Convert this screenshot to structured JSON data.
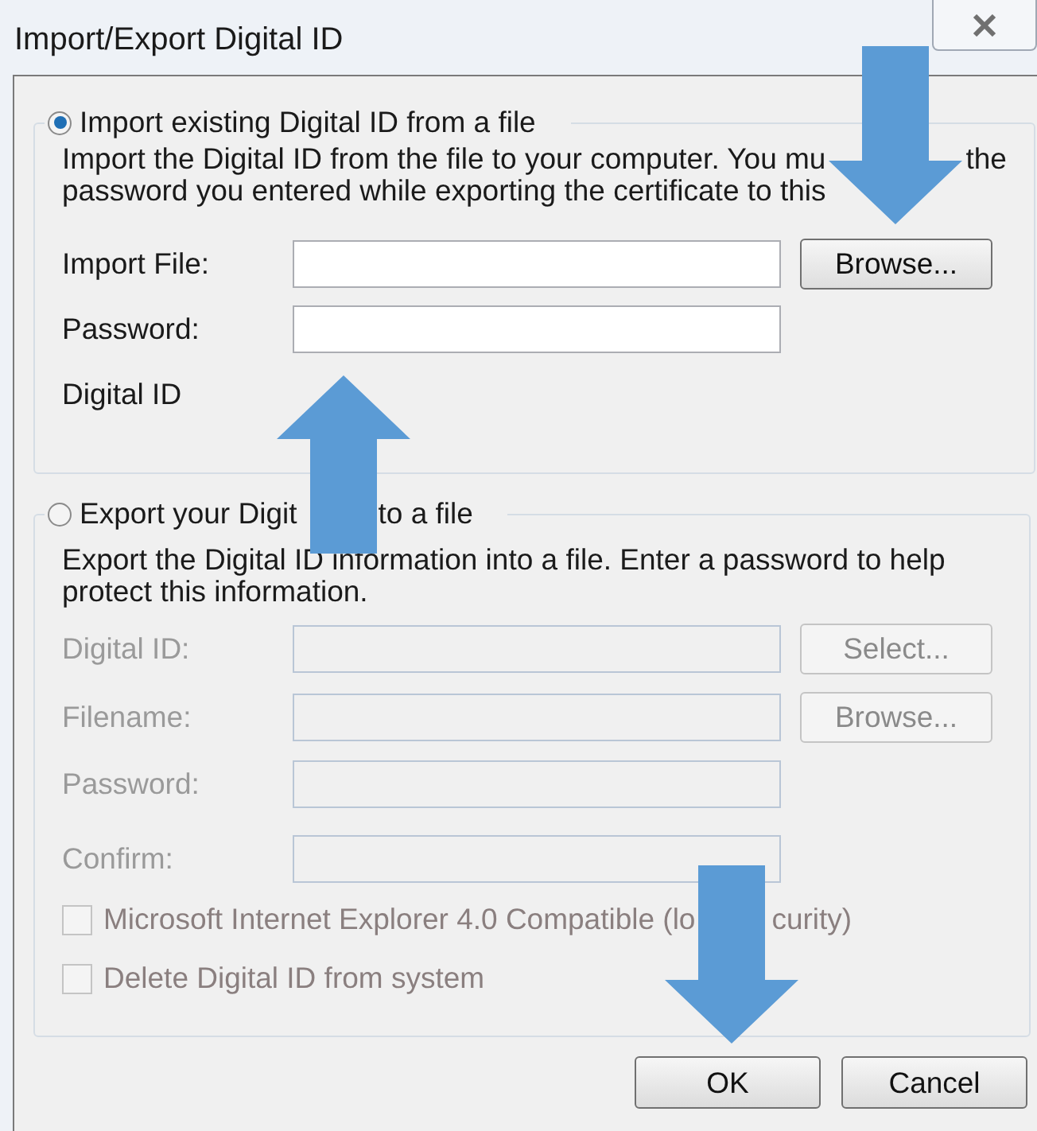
{
  "window": {
    "title": "Import/Export Digital ID"
  },
  "import_section": {
    "selected": true,
    "label": [
      "Import existing Digital ID from a file"
    ],
    "description": [
      [
        "Import the Digital ID from the file to your computer. You mu",
        "the"
      ],
      [
        "password you entered while exporting the certificate to this"
      ]
    ],
    "fields": [
      {
        "label": "Import File:",
        "disabled": false,
        "button": "Browse..."
      },
      {
        "label": "Password:",
        "disabled": false
      }
    ],
    "digital_id_label": "Digital ID"
  },
  "export_section": {
    "selected": false,
    "label": [
      "Export your Digit",
      "to a file"
    ],
    "description": [
      [
        "Export the Digital ID information into a file. Enter a password to help"
      ],
      [
        "protect this information."
      ]
    ],
    "fields": [
      {
        "label": "Digital ID:",
        "disabled": true,
        "button": "Select..."
      },
      {
        "label": "Filename:",
        "disabled": true,
        "button": "Browse..."
      },
      {
        "label": "Password:",
        "disabled": true
      },
      {
        "label": "Confirm:",
        "disabled": true
      }
    ],
    "checkboxes": [
      {
        "label": [
          "Microsoft Internet Explorer 4.0 Compatible (lo",
          "curity)"
        ],
        "checked": false,
        "disabled": true
      },
      {
        "label": [
          "Delete Digital ID from system"
        ],
        "checked": false,
        "disabled": true
      }
    ]
  },
  "buttons": [
    "OK",
    "Cancel"
  ],
  "annotations": [
    {
      "kind": "arrow_down"
    },
    {
      "kind": "arrow_up"
    },
    {
      "kind": "arrow_down"
    }
  ]
}
